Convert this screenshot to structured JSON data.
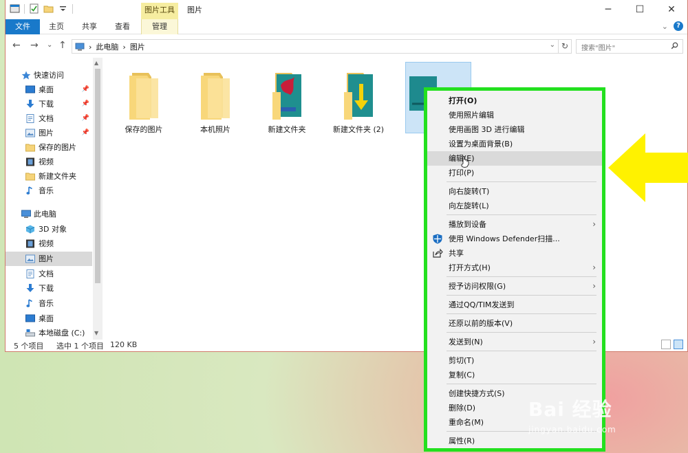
{
  "window": {
    "title": "图片",
    "context_tab_head": "图片工具",
    "controls": {
      "minimize": "─",
      "maximize": "☐",
      "close": "✕"
    }
  },
  "ribbon": {
    "tabs": [
      "文件",
      "主页",
      "共享",
      "查看",
      "管理"
    ],
    "collapse": "⌄",
    "help": "?"
  },
  "address": {
    "back": "←",
    "forward": "→",
    "recent": "⌄",
    "up": "↑",
    "crumbs": [
      "此电脑",
      "图片"
    ],
    "crumb_sep": "›",
    "dropdown": "⌄",
    "refresh": "↻",
    "search_placeholder": "搜索\"图片\""
  },
  "sidebar": {
    "quick_access": "快速访问",
    "quick_items": [
      {
        "label": "桌面",
        "pinned": true
      },
      {
        "label": "下载",
        "pinned": true
      },
      {
        "label": "文档",
        "pinned": true
      },
      {
        "label": "图片",
        "pinned": true
      },
      {
        "label": "保存的图片",
        "pinned": false
      },
      {
        "label": "视频",
        "pinned": false
      },
      {
        "label": "新建文件夹",
        "pinned": false
      },
      {
        "label": "音乐",
        "pinned": false
      }
    ],
    "this_pc": "此电脑",
    "pc_items": [
      "3D 对象",
      "视频",
      "图片",
      "文档",
      "下载",
      "音乐",
      "桌面",
      "本地磁盘 (C:)"
    ],
    "selected": "图片"
  },
  "files": [
    {
      "label": "保存的图片",
      "kind": "folder"
    },
    {
      "label": "本机照片",
      "kind": "folder"
    },
    {
      "label": "新建文件夹",
      "kind": "folder-image"
    },
    {
      "label": "新建文件夹 (2)",
      "kind": "folder-arrow"
    },
    {
      "label": "",
      "kind": "image",
      "selected": true
    }
  ],
  "status": {
    "count": "5 个项目",
    "selection": "选中 1 个项目",
    "size": "120 KB"
  },
  "context_menu": {
    "items": [
      {
        "label": "打开(O)",
        "bold": true
      },
      {
        "label": "使用照片编辑"
      },
      {
        "label": "使用画图 3D 进行编辑"
      },
      {
        "label": "设置为桌面背景(B)"
      },
      {
        "label": "编辑(E)",
        "highlighted": true
      },
      {
        "label": "打印(P)"
      },
      {
        "label": "向右旋转(T)"
      },
      {
        "label": "向左旋转(L)"
      },
      {
        "label": "播放到设备",
        "submenu": true
      },
      {
        "label": "使用 Windows Defender扫描...",
        "icon": "defender-shield-icon"
      },
      {
        "label": "共享",
        "icon": "share-icon"
      },
      {
        "label": "打开方式(H)",
        "submenu": true
      },
      {
        "label": "授予访问权限(G)",
        "submenu": true
      },
      {
        "label": "通过QQ/TIM发送到"
      },
      {
        "label": "还原以前的版本(V)"
      },
      {
        "label": "发送到(N)",
        "submenu": true
      },
      {
        "label": "剪切(T)"
      },
      {
        "label": "复制(C)"
      },
      {
        "label": "创建快捷方式(S)"
      },
      {
        "label": "删除(D)"
      },
      {
        "label": "重命名(M)"
      },
      {
        "label": "属性(R)"
      }
    ],
    "submenu_arrow": "›"
  },
  "watermark": {
    "brand": "Bai 经验",
    "url": "jingyan.baidu.com"
  },
  "colors": {
    "accent": "#1979ca",
    "highlight_border": "#23e01f",
    "arrow": "#fff200"
  }
}
